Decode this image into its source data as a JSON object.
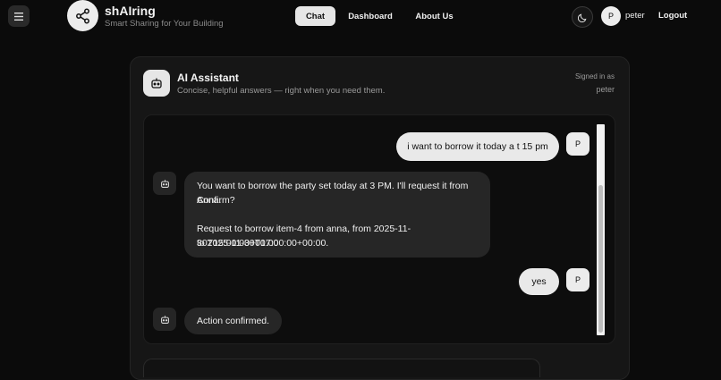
{
  "header": {
    "brand_name": "shAIring",
    "brand_tagline": "Smart Sharing for Your Building",
    "nav": [
      {
        "label": "Chat",
        "active": true
      },
      {
        "label": "Dashboard",
        "active": false
      },
      {
        "label": "About Us",
        "active": false
      }
    ],
    "user_initial": "P",
    "user_name": "peter",
    "logout_label": "Logout",
    "icons": {
      "menu": "menu-icon",
      "logo": "share-icon",
      "theme": "moon-icon"
    }
  },
  "assistant": {
    "title": "AI Assistant",
    "subtitle": "Concise, helpful answers — right when you need them.",
    "signed_in_label": "Signed in as",
    "signed_in_user": "peter",
    "icon": "robot-icon"
  },
  "messages": [
    {
      "role": "user",
      "avatar": "P",
      "text": "i want to borrow it today a t 15 pm"
    },
    {
      "role": "assistant",
      "lines": [
        "You want to borrow the party set today at 3 PM. I'll request it from Anna.",
        "Confirm?",
        "",
        "Request to borrow item-4 from anna, from 2025-11-30T15:00:00+00:00",
        "to 2025-11-30T17:00:00+00:00."
      ]
    },
    {
      "role": "user",
      "avatar": "P",
      "text": "yes"
    },
    {
      "role": "assistant",
      "text": "Action confirmed."
    }
  ],
  "colors": {
    "background": "#0b0b0b",
    "card": "#161616",
    "user_bubble": "#e9e9e9",
    "bot_bubble": "#262626"
  }
}
